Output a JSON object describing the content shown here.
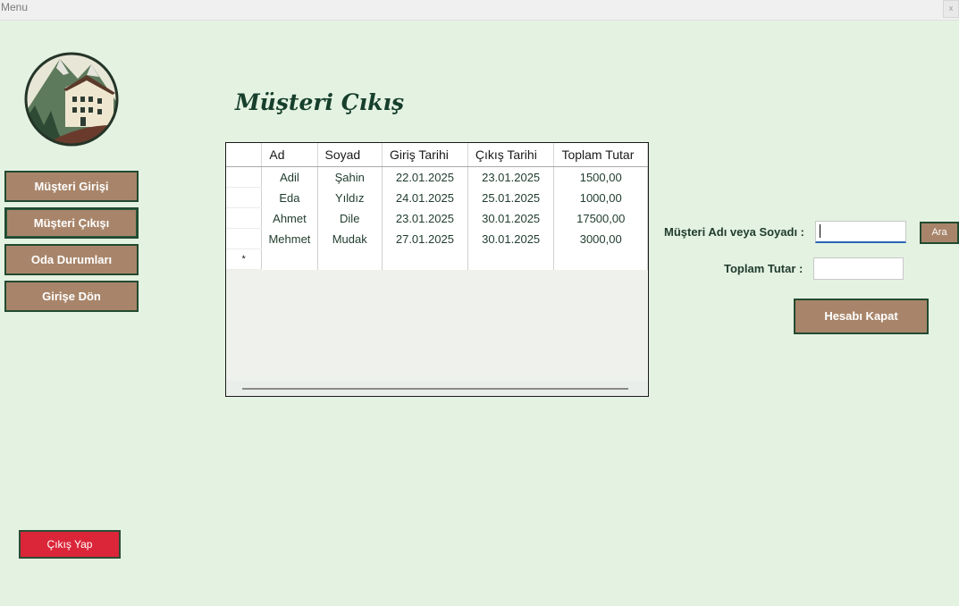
{
  "window": {
    "title": "Menu",
    "close_label": "x"
  },
  "logo": {
    "name": "mountain-house-logo"
  },
  "nav": {
    "items": [
      {
        "label": "Müşteri Girişi"
      },
      {
        "label": "Müşteri Çıkışı"
      },
      {
        "label": "Oda Durumları"
      },
      {
        "label": "Girişe Dön"
      }
    ],
    "exit_label": "Çıkış Yap"
  },
  "page": {
    "title": "Müşteri Çıkış"
  },
  "table": {
    "columns": [
      "Ad",
      "Soyad",
      "Giriş Tarihi",
      "Çıkış Tarihi",
      "Toplam Tutar"
    ],
    "rows": [
      [
        "Adil",
        "Şahin",
        "22.01.2025",
        "23.01.2025",
        "1500,00"
      ],
      [
        "Eda",
        "Yıldız",
        "24.01.2025",
        "25.01.2025",
        "1000,00"
      ],
      [
        "Ahmet",
        "Dile",
        "23.01.2025",
        "30.01.2025",
        "17500,00"
      ],
      [
        "Mehmet",
        "Mudak",
        "27.01.2025",
        "30.01.2025",
        "3000,00"
      ]
    ],
    "new_row_marker": "*"
  },
  "form": {
    "search_label": "Müşteri Adı veya Soyadı :",
    "search_value": "",
    "search_button": "Ara",
    "total_label": "Toplam Tutar :",
    "total_value": "",
    "close_account_button": "Hesabı Kapat"
  },
  "colors": {
    "background": "#e4f2e2",
    "button": "#a8856a",
    "button_border": "#214a30",
    "exit_button": "#db2538",
    "title": "#163f2c"
  }
}
